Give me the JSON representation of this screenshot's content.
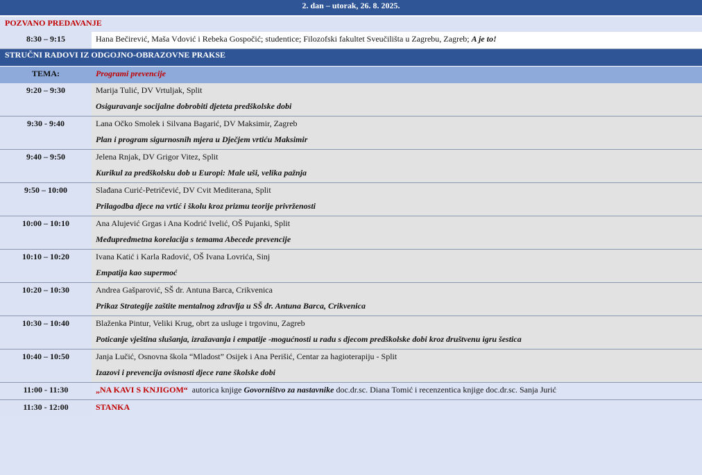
{
  "header": "2. dan – utorak, 26. 8. 2025.",
  "invited": {
    "label": "POZVANO PREDAVANJE",
    "time": "8:30 – 9:15",
    "text": "Hana Bečirević, Maša Vdović i Rebeka Gospočić; studentice; Filozofski fakultet Sveučilišta u Zagrebu, Zagreb; ",
    "title": "A je to!"
  },
  "section": "STRUČNI RADOVI IZ ODGOJNO-OBRAZOVNE PRAKSE",
  "tema": {
    "label": "TEMA:",
    "value": "Programi prevencije"
  },
  "talks": [
    {
      "time": "9:20 – 9:30",
      "author": "Marija Tulić, DV Vrtuljak, Split",
      "title": "Osiguravanje socijalne dobrobiti djeteta predškolske dobi"
    },
    {
      "time": "9:30  - 9:40",
      "author": "Lana Očko Smolek  i Silvana Bagarić, DV Maksimir,  Zagreb",
      "title": "Plan i program sigurnosnih mjera u Dječjem vrtiću Maksimir"
    },
    {
      "time": "9:40 – 9:50",
      "author": "Jelena Rnjak, DV Grigor Vitez, Split",
      "title": "Kurikul za predškolsku dob u Europi: Male uši, velika pažnja"
    },
    {
      "time": "9:50 – 10:00",
      "author": "Slađana Curić-Petričević, DV Cvit Mediterana, Split",
      "title": "Prilagodba djece na vrtić i školu kroz prizmu teorije privrženosti"
    },
    {
      "time": "10:00 – 10:10",
      "author": "Ana Alujević Grgas i Ana Kodrić Ivelić, OŠ Pujanki, Split",
      "title": "Međupredmetna korelacija s temama Abecede prevencije"
    },
    {
      "time": "10:10 – 10:20",
      "author": "Ivana Katić i Karla Radović, OŠ Ivana Lovrića, Sinj",
      "title": "Empatija kao supermoć"
    },
    {
      "time": "10:20 – 10:30",
      "author": "Andrea Gašparović, SŠ dr. Antuna Barca, Crikvenica",
      "title": "Prikaz Strategije zaštite mentalnog zdravlja u SŠ dr. Antuna Barca, Crikvenica"
    },
    {
      "time": "10:30 – 10:40",
      "author": "Blaženka Pintur, Veliki Krug, obrt za usluge i trgovinu, Zagreb",
      "title": "Poticanje vještina slušanja, izražavanja i empatije -mogućnosti u radu s djecom predškolske dobi kroz društvenu igru šestica"
    },
    {
      "time": "10:40 – 10:50",
      "author": "Janja  Lučić, Osnovna škola “Mladost” Osijek i Ana Perišić, Centar za hagioterapiju - Split",
      "title": "Izazovi i prevencija ovisnosti djece rane školske dobi"
    }
  ],
  "coffee": {
    "time": "11:00 - 11:30",
    "label": "„NA KAVI  S KNJIGOM“",
    "t1": "  autorica knjige ",
    "book": "Govorništvo za nastavnike",
    "t2": " doc.dr.sc. Diana Tomić i recenzentica knjige doc.dr.sc. Sanja Jurić"
  },
  "pause": {
    "time": "11:30 - 12:00",
    "label": "STANKA"
  }
}
